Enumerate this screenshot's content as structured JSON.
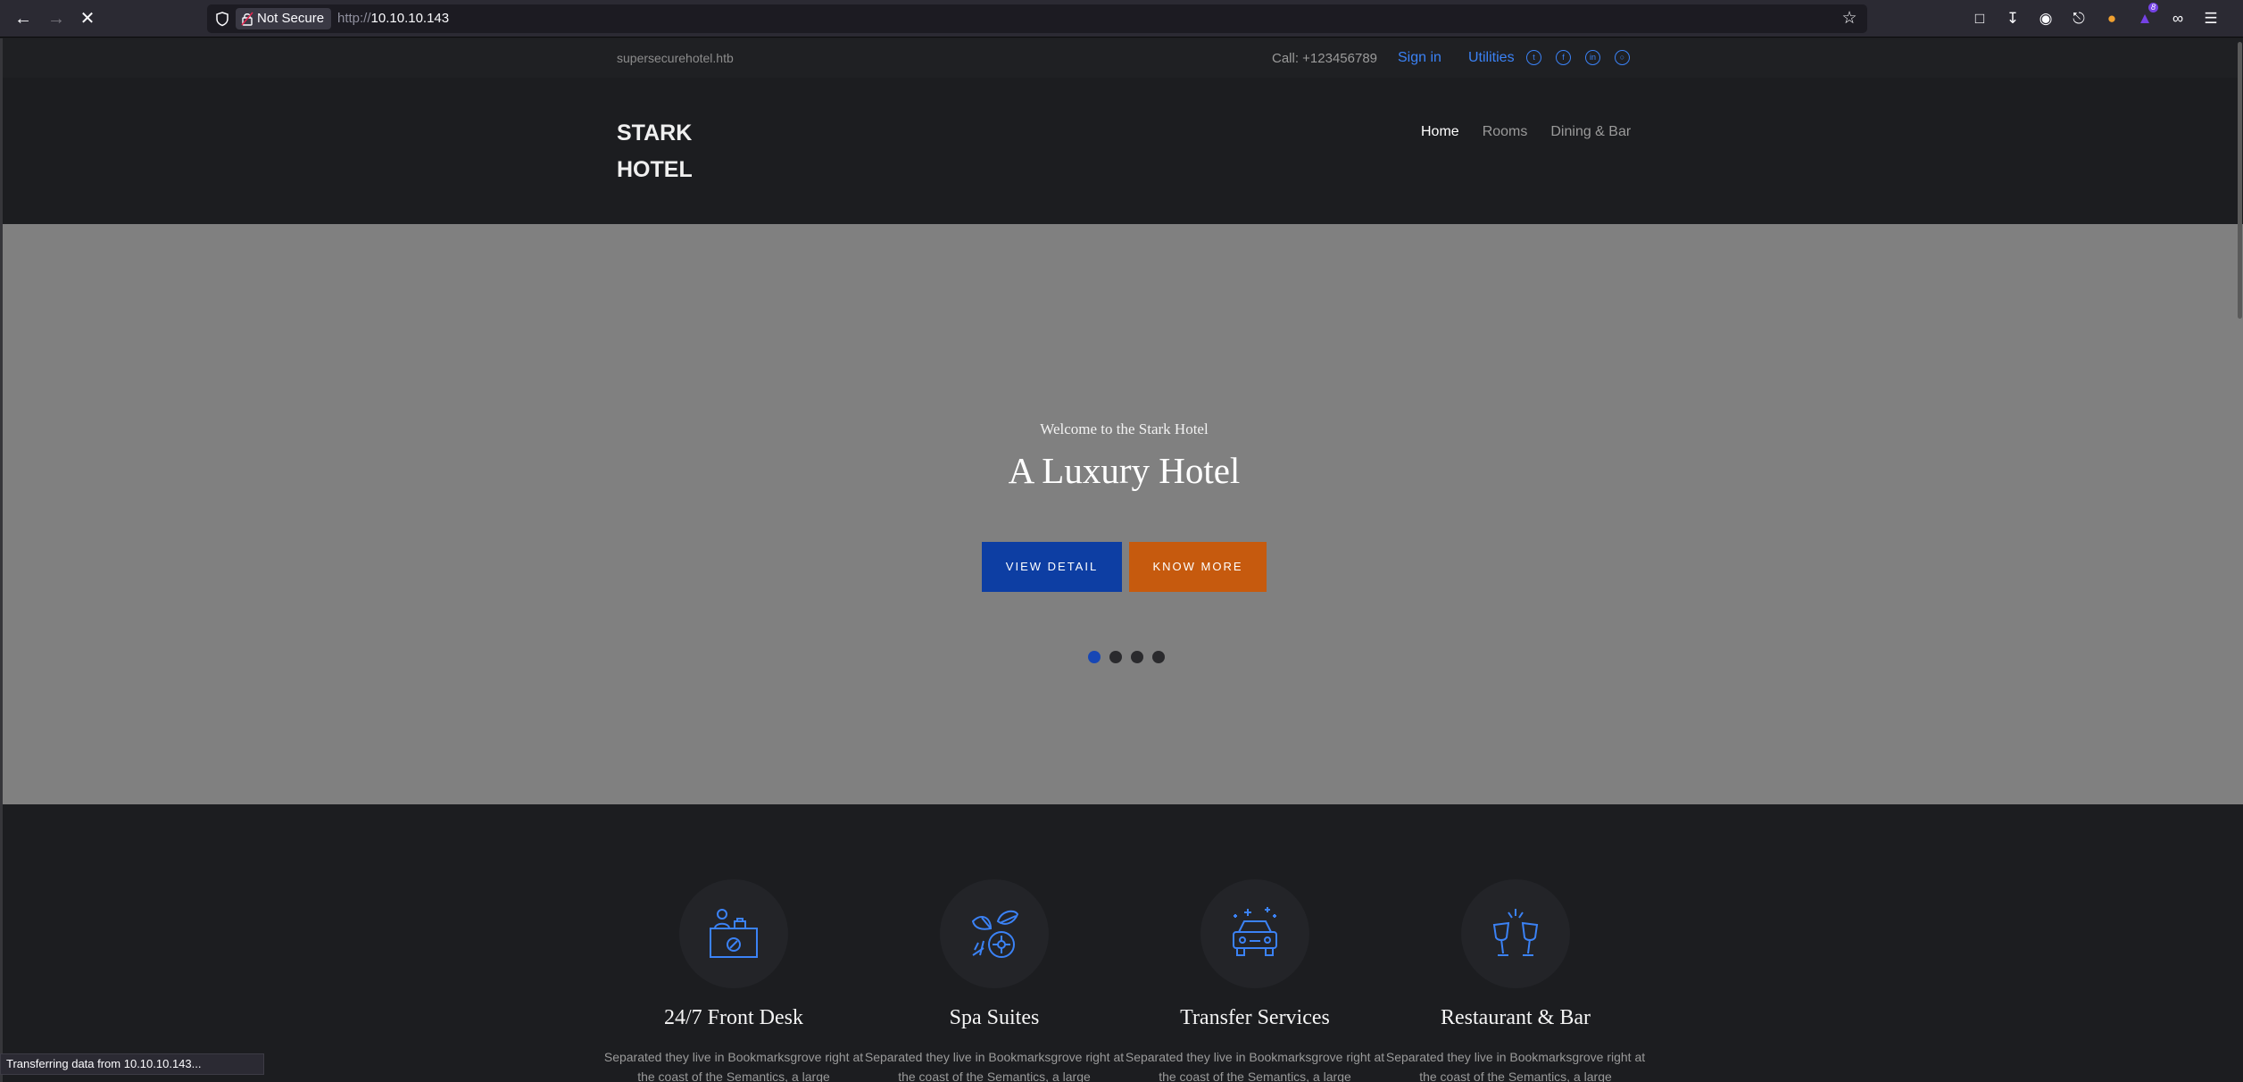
{
  "browser": {
    "url_scheme": "http://",
    "url_host": "10.10.10.143",
    "security_label": "Not Secure",
    "extension_badge": "8",
    "status_text": "Transferring data from 10.10.10.143..."
  },
  "topbar": {
    "domain": "supersecurehotel.htb",
    "call": "Call: +123456789",
    "signin": "Sign in",
    "utilities": "Utilities",
    "social_icons": [
      "twitter-icon",
      "facebook-icon",
      "linkedin-icon",
      "instagram-icon"
    ]
  },
  "header": {
    "brand_line1": "STARK",
    "brand_line2": "HOTEL",
    "nav": [
      {
        "label": "Home",
        "active": true
      },
      {
        "label": "Rooms",
        "active": false
      },
      {
        "label": "Dining & Bar",
        "active": false
      }
    ]
  },
  "hero": {
    "kicker": "Welcome to the Stark Hotel",
    "title": "A Luxury Hotel",
    "btn_primary": "VIEW DETAIL",
    "btn_secondary": "KNOW MORE",
    "slide_count": 4,
    "active_slide": 1
  },
  "services": [
    {
      "title": "24/7 Front Desk",
      "text": "Separated they live in Bookmarksgrove right at the coast of the Semantics, a large",
      "icon": "front-desk-icon"
    },
    {
      "title": "Spa Suites",
      "text": "Separated they live in Bookmarksgrove right at the coast of the Semantics, a large",
      "icon": "spa-icon"
    },
    {
      "title": "Transfer Services",
      "text": "Separated they live in Bookmarksgrove right at the coast of the Semantics, a large",
      "icon": "car-icon"
    },
    {
      "title": "Restaurant & Bar",
      "text": "Separated they live in Bookmarksgrove right at the coast of the Semantics, a large",
      "icon": "glasses-icon"
    }
  ],
  "colors": {
    "accent_blue": "#3b82f6",
    "button_blue": "#0d3ea3",
    "button_orange": "#c65a0e",
    "hero_bg": "#808080",
    "page_bg": "#1c1d20"
  }
}
